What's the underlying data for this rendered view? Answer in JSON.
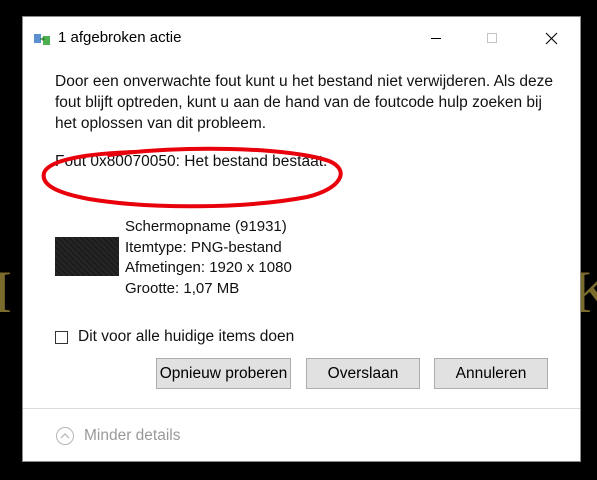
{
  "window": {
    "title": "1 afgebroken actie",
    "minimize_icon": "minimize-icon",
    "maximize_icon": "maximize-icon",
    "close_icon": "close-icon"
  },
  "message": "Door een onverwachte fout kunt u het bestand niet verwijderen. Als deze fout blijft optreden, kunt u aan de hand van de foutcode hulp zoeken bij het oplossen van dit probleem.",
  "error_code": "Fout 0x80070050: Het bestand bestaat.",
  "file": {
    "name": "Schermopname (91931)",
    "type": "Itemtype: PNG-bestand",
    "dimensions": "Afmetingen: 1920 x 1080",
    "size": "Grootte: 1,07 MB"
  },
  "checkbox": {
    "label": "Dit voor alle huidige items doen",
    "checked": false
  },
  "buttons": {
    "retry": "Opnieuw proberen",
    "skip": "Overslaan",
    "cancel": "Annuleren"
  },
  "details": {
    "label": "Minder details",
    "icon": "chevron-up-icon"
  },
  "colors": {
    "annotation": "#e8000b",
    "dialog_bg": "#ffffff",
    "button_bg": "#e1e1e1"
  }
}
